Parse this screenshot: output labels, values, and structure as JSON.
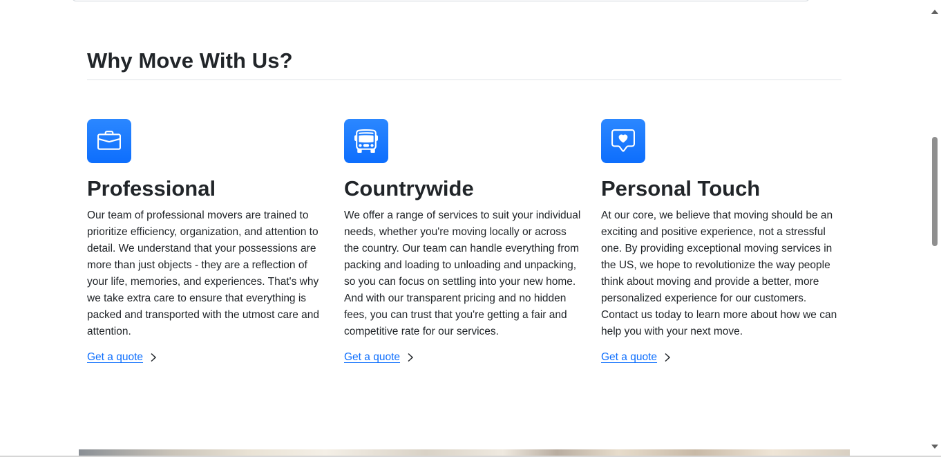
{
  "section": {
    "title": "Why Move With Us?"
  },
  "features": [
    {
      "icon": "briefcase-icon",
      "title": "Professional",
      "text": "Our team of professional movers are trained to prioritize efficiency, organization, and attention to detail. We understand that your possessions are more than just objects - they are a reflection of your life, memories, and experiences. That's why we take extra care to ensure that everything is packed and transported with the utmost care and attention.",
      "link": "Get a quote"
    },
    {
      "icon": "bus-icon",
      "title": "Countrywide",
      "text": "We offer a range of services to suit your individual needs, whether you're moving locally or across the country. Our team can handle everything from packing and loading to unloading and unpacking, so you can focus on settling into your new home. And with our transparent pricing and no hidden fees, you can trust that you're getting a fair and competitive rate for our services.",
      "link": "Get a quote"
    },
    {
      "icon": "chat-heart-icon",
      "title": "Personal Touch",
      "text": "At our core, we believe that moving should be an exciting and positive experience, not a stressful one. By providing exceptional moving services in the US, we hope to revolutionize the way people think about moving and provide a better, more personalized experience for our customers. Contact us today to learn more about how we can help you with your next move.",
      "link": "Get a quote"
    }
  ],
  "colors": {
    "accent": "#0d6efd",
    "text": "#212529"
  }
}
